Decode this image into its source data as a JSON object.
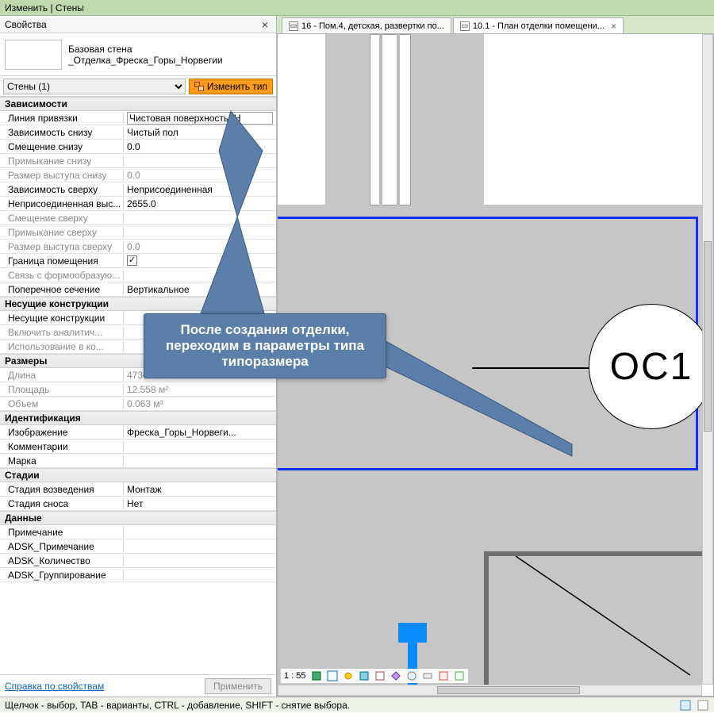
{
  "titlebar": "Изменить | Стены",
  "properties": {
    "header_title": "Свойства",
    "type_line1": "Базовая стена",
    "type_line2": "_Отделка_Фреска_Горы_Норвегии",
    "selector": "Стены (1)",
    "edit_type_btn": "Изменить тип",
    "help_link": "Справка по свойствам",
    "apply_btn": "Применить",
    "groups": [
      {
        "title": "Зависимости",
        "rows": [
          {
            "label": "Линия привязки",
            "value": "Чистовая поверхность: Н",
            "editable": true,
            "disabled": false
          },
          {
            "label": "Зависимость снизу",
            "value": "Чистый пол",
            "disabled": false
          },
          {
            "label": "Смещение снизу",
            "value": "0.0",
            "disabled": false
          },
          {
            "label": "Примыкание снизу",
            "value": "",
            "disabled": true
          },
          {
            "label": "Размер выступа снизу",
            "value": "0.0",
            "disabled": true
          },
          {
            "label": "Зависимость сверху",
            "value": "Неприсоединенная",
            "disabled": false
          },
          {
            "label": "Неприсоединенная выс...",
            "value": "2655.0",
            "disabled": false
          },
          {
            "label": "Смещение сверху",
            "value": "",
            "disabled": true
          },
          {
            "label": "Примыкание сверху",
            "value": "",
            "disabled": true
          },
          {
            "label": "Размер выступа сверху",
            "value": "0.0",
            "disabled": true
          },
          {
            "label": "Граница помещения",
            "value": "checkbox:true",
            "disabled": false
          },
          {
            "label": "Связь с формообразую...",
            "value": "",
            "disabled": true
          },
          {
            "label": "Поперечное сечение",
            "value": "Вертикальное",
            "disabled": false
          }
        ]
      },
      {
        "title": "Несущие конструкции",
        "rows": [
          {
            "label": "Несущие конструкции",
            "value": "",
            "disabled": false
          },
          {
            "label": "Включить аналитич...",
            "value": "",
            "disabled": true
          },
          {
            "label": "Использование в ко...",
            "value": "",
            "disabled": true
          }
        ]
      },
      {
        "title": "Размеры",
        "rows": [
          {
            "label": "Длина",
            "value": "4730.0",
            "disabled": true
          },
          {
            "label": "Площадь",
            "value": "12.558 м²",
            "disabled": true
          },
          {
            "label": "Объем",
            "value": "0.063 м³",
            "disabled": true
          }
        ]
      },
      {
        "title": "Идентификация",
        "rows": [
          {
            "label": "Изображение",
            "value": "Фреска_Горы_Норвеги...",
            "disabled": false
          },
          {
            "label": "Комментарии",
            "value": "",
            "disabled": false
          },
          {
            "label": "Марка",
            "value": "",
            "disabled": false
          }
        ]
      },
      {
        "title": "Стадии",
        "rows": [
          {
            "label": "Стадия возведения",
            "value": "Монтаж",
            "disabled": false
          },
          {
            "label": "Стадия сноса",
            "value": "Нет",
            "disabled": false
          }
        ]
      },
      {
        "title": "Данные",
        "rows": [
          {
            "label": "Примечание",
            "value": "",
            "disabled": false
          },
          {
            "label": "ADSK_Примечание",
            "value": "",
            "disabled": false
          },
          {
            "label": "ADSK_Количество",
            "value": "",
            "disabled": false
          },
          {
            "label": "ADSK_Группирование",
            "value": "",
            "disabled": false
          }
        ]
      }
    ]
  },
  "tabs": [
    {
      "label": "16 - Пом.4, детская, развертки по...",
      "active": false
    },
    {
      "label": "10.1 - План отделки помещени...",
      "active": true
    }
  ],
  "view": {
    "scale": "1 : 55",
    "marker_label": "ОС1"
  },
  "callout_text": "После создания отделки, переходим в параметры типа типоразмера",
  "status_text": "Щелчок - выбор, TAB - варианты, CTRL - добавление, SHIFT - снятие выбора."
}
